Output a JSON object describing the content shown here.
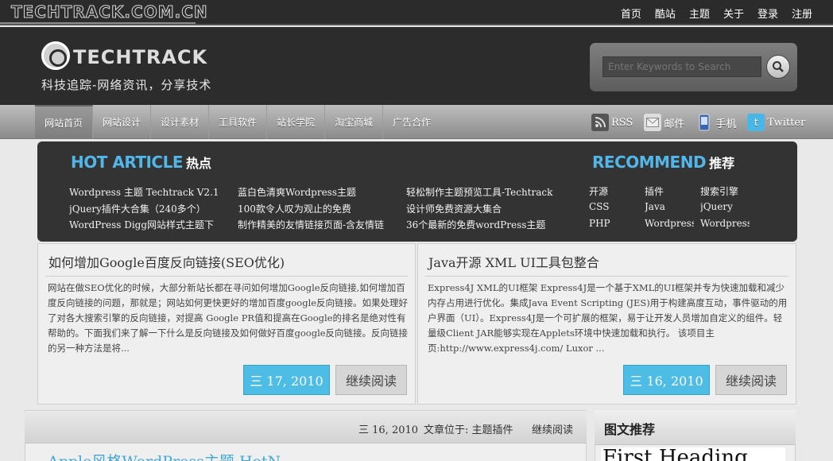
{
  "topbar": {
    "site_url": "TECHTRACK.COM.CN",
    "links": [
      "首页",
      "酷站",
      "主题",
      "关于",
      "登录",
      "注册"
    ]
  },
  "header": {
    "logo_text": "TECHTRACK",
    "tagline": "科技追踪-网络资讯，分享技术",
    "search_placeholder": "Enter Keywords to Search"
  },
  "nav": {
    "items": [
      "网站首页",
      "网站设计",
      "设计素材",
      "工具软件",
      "站长学院",
      "淘宝商城",
      "广告合作"
    ],
    "active_index": 0,
    "social": [
      {
        "icon": "rss-icon",
        "label": "RSS"
      },
      {
        "icon": "mail-icon",
        "label": "邮件"
      },
      {
        "icon": "mobile-icon",
        "label": "手机"
      },
      {
        "icon": "twitter-icon",
        "label": "Twitter"
      }
    ]
  },
  "hot": {
    "heading_en": "HOT ARTICLE",
    "heading_cn": "热点",
    "columns": [
      [
        "Wordpress 主题  Techtrack V2.1",
        "jQuery插件大合集（240多个）",
        "WordPress Digg网站样式主题下"
      ],
      [
        "蓝白色清爽Wordpress主题",
        "100款令人叹为观止的免费",
        "制作精美的友情链接页面-含友情链"
      ],
      [
        "轻松制作主题预览工具-Techtrack",
        "设计师免费资源大集合",
        "36个最新的免费wordPress主题"
      ]
    ]
  },
  "recommend": {
    "heading_en": "RECOMMEND",
    "heading_cn": "推荐",
    "columns": [
      [
        "开源",
        "CSS",
        "PHP"
      ],
      [
        "插件",
        "Java",
        "Wordpress"
      ],
      [
        "搜索引擎",
        "jQuery",
        "Wordpress"
      ]
    ]
  },
  "posts": [
    {
      "title": "如何增加Google百度反向链接(SEO优化)",
      "excerpt": "网站在做SEO优化的时候，大部分新站长都在寻问如何增加Google反向链接,如何增加百度反向链接的问题，那就是；网站如何更快更好的增加百度google反向链接。如果处理好了对各大搜索引擎的反向链接，对提高  Google PR值和提高在Google的排名是绝对性有帮助的。下面我们来了解一下什么是反向链接及如何做好百度google反向链接。反向链接的另一种方法是将...",
      "date": "三  17, 2010",
      "more": "继续阅读"
    },
    {
      "title": "Java开源  XML UI工具包整合",
      "excerpt": "Express4J XML的UI框架  Express4J是一个基于XML的UI框架并专为快速加载和减少内存占用进行优化。集成Java Event Scripting (JES)用于构建高度互动，事件驱动的用户界面（UI）。Express4J是一个可扩展的框架，易于让开发人员增加自定义的组件。轻量级Client JAR能够实现在Applets环境中快速加载和执行。  该项目主页:http://www.express4j.com/ Luxor ...",
      "date": "三  16, 2010",
      "more": "继续阅读"
    }
  ],
  "bottom_post": {
    "date": "三  16, 2010",
    "category_label": "文章位于: 主题插件",
    "more": "继续阅读",
    "title_partial": "Apple风格WordPress主题 HotN"
  },
  "sidebar": {
    "heading": "图文推荐",
    "image_text": "First Heading"
  }
}
